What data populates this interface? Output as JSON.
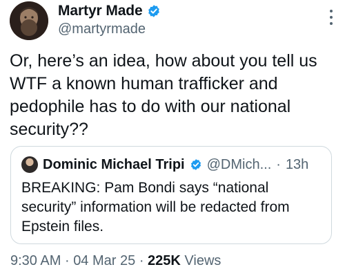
{
  "author": {
    "display_name": "Martyr Made",
    "handle": "@martyrmade",
    "verified": true
  },
  "tweet": {
    "text": "Or, here’s an idea, how about you tell us WTF a known human trafficker and pedophile has to do with our national security??"
  },
  "quoted_tweet": {
    "display_name": "Dominic Michael Tripi",
    "handle": "@DMich...",
    "separator": "·",
    "time": "13h",
    "verified": true,
    "text": "BREAKING: Pam Bondi says “national security” information will be redacted from Epstein files."
  },
  "meta": {
    "time": "9:30 AM",
    "sep1": "·",
    "date": "04 Mar 25",
    "sep2": "·",
    "views_count": "225K",
    "views_label": "Views"
  },
  "colors": {
    "verified_blue": "#1d9bf0",
    "secondary_text": "#536471",
    "border": "#cfd9de"
  },
  "icons": {
    "more": "more-vertical-icon",
    "verified": "verified-badge-icon"
  }
}
